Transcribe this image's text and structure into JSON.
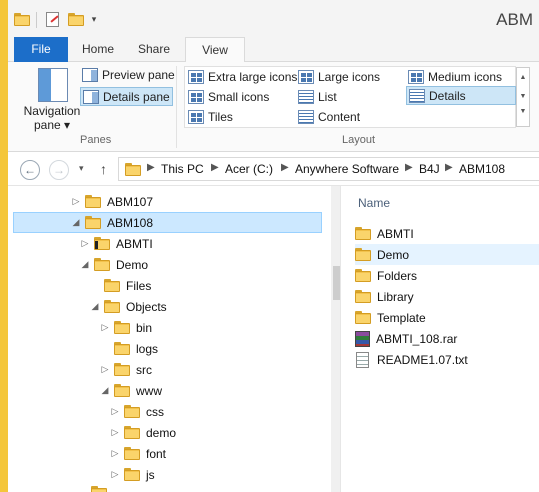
{
  "window": {
    "title": "ABM"
  },
  "ribbon_tabs": {
    "file": "File",
    "home": "Home",
    "share": "Share",
    "view": "View"
  },
  "panes_group": {
    "navigation_pane_label1": "Navigation",
    "navigation_pane_label2": "pane ▾",
    "preview_pane": "Preview pane",
    "details_pane": "Details pane",
    "group_label": "Panes"
  },
  "layout_group": {
    "extra_large_icons": "Extra large icons",
    "large_icons": "Large icons",
    "medium_icons": "Medium icons",
    "small_icons": "Small icons",
    "list": "List",
    "details": "Details",
    "tiles": "Tiles",
    "content": "Content",
    "group_label": "Layout"
  },
  "address_bar": {
    "back_icon": "←",
    "forward_icon": "→",
    "recent_icon": "▾",
    "up_icon": "↑",
    "crumbs": [
      "This PC",
      "Acer (C:)",
      "Anywhere Software",
      "B4J",
      "ABM108"
    ]
  },
  "tree": [
    {
      "label": "ABM107",
      "expander": "▷"
    },
    {
      "label": "ABM108",
      "expander": "◢"
    },
    {
      "label": "ABMTI",
      "expander": "▷"
    },
    {
      "label": "Demo",
      "expander": "◢"
    },
    {
      "label": "Files",
      "expander": ""
    },
    {
      "label": "Objects",
      "expander": "◢"
    },
    {
      "label": "bin",
      "expander": "▷"
    },
    {
      "label": "logs",
      "expander": ""
    },
    {
      "label": "src",
      "expander": "▷"
    },
    {
      "label": "www",
      "expander": "◢"
    },
    {
      "label": "css",
      "expander": "▷"
    },
    {
      "label": "demo",
      "expander": "▷"
    },
    {
      "label": "font",
      "expander": "▷"
    },
    {
      "label": "js",
      "expander": "▷"
    }
  ],
  "files": {
    "column_name": "Name",
    "items": [
      {
        "name": "ABMTI",
        "kind": "folder"
      },
      {
        "name": "Demo",
        "kind": "folder"
      },
      {
        "name": "Folders",
        "kind": "folder"
      },
      {
        "name": "Library",
        "kind": "folder"
      },
      {
        "name": "Template",
        "kind": "folder"
      },
      {
        "name": "ABMTI_108.rar",
        "kind": "rar"
      },
      {
        "name": "README1.07.txt",
        "kind": "txt"
      }
    ]
  },
  "colors": {
    "accent": "#1c6ec9",
    "selection": "#cce8ff",
    "folder": "#f2c24c"
  }
}
